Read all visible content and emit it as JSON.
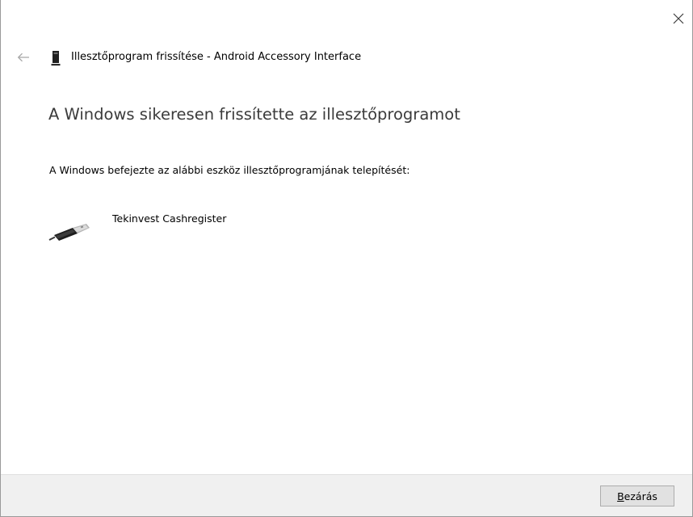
{
  "window": {
    "close_label": "Close",
    "back_label": "Back"
  },
  "header": {
    "title": "Illesztőprogram frissítése - Android Accessory Interface"
  },
  "main": {
    "heading": "A Windows sikeresen frissítette az illesztőprogramot",
    "description": "A Windows befejezte az alábbi eszköz illesztőprogramjának telepítését:",
    "device_name": "Tekinvest Cashregister"
  },
  "footer": {
    "close_button_mnemonic": "B",
    "close_button_rest": "ezárás"
  },
  "icons": {
    "close": "close-icon",
    "back": "back-arrow-icon",
    "title": "device-icon",
    "device": "usb-plug-icon"
  },
  "colors": {
    "heading": "#3b3b3b",
    "footer_bg": "#f0f0f0",
    "button_bg": "#e1e1e1",
    "button_border": "#adadad"
  }
}
